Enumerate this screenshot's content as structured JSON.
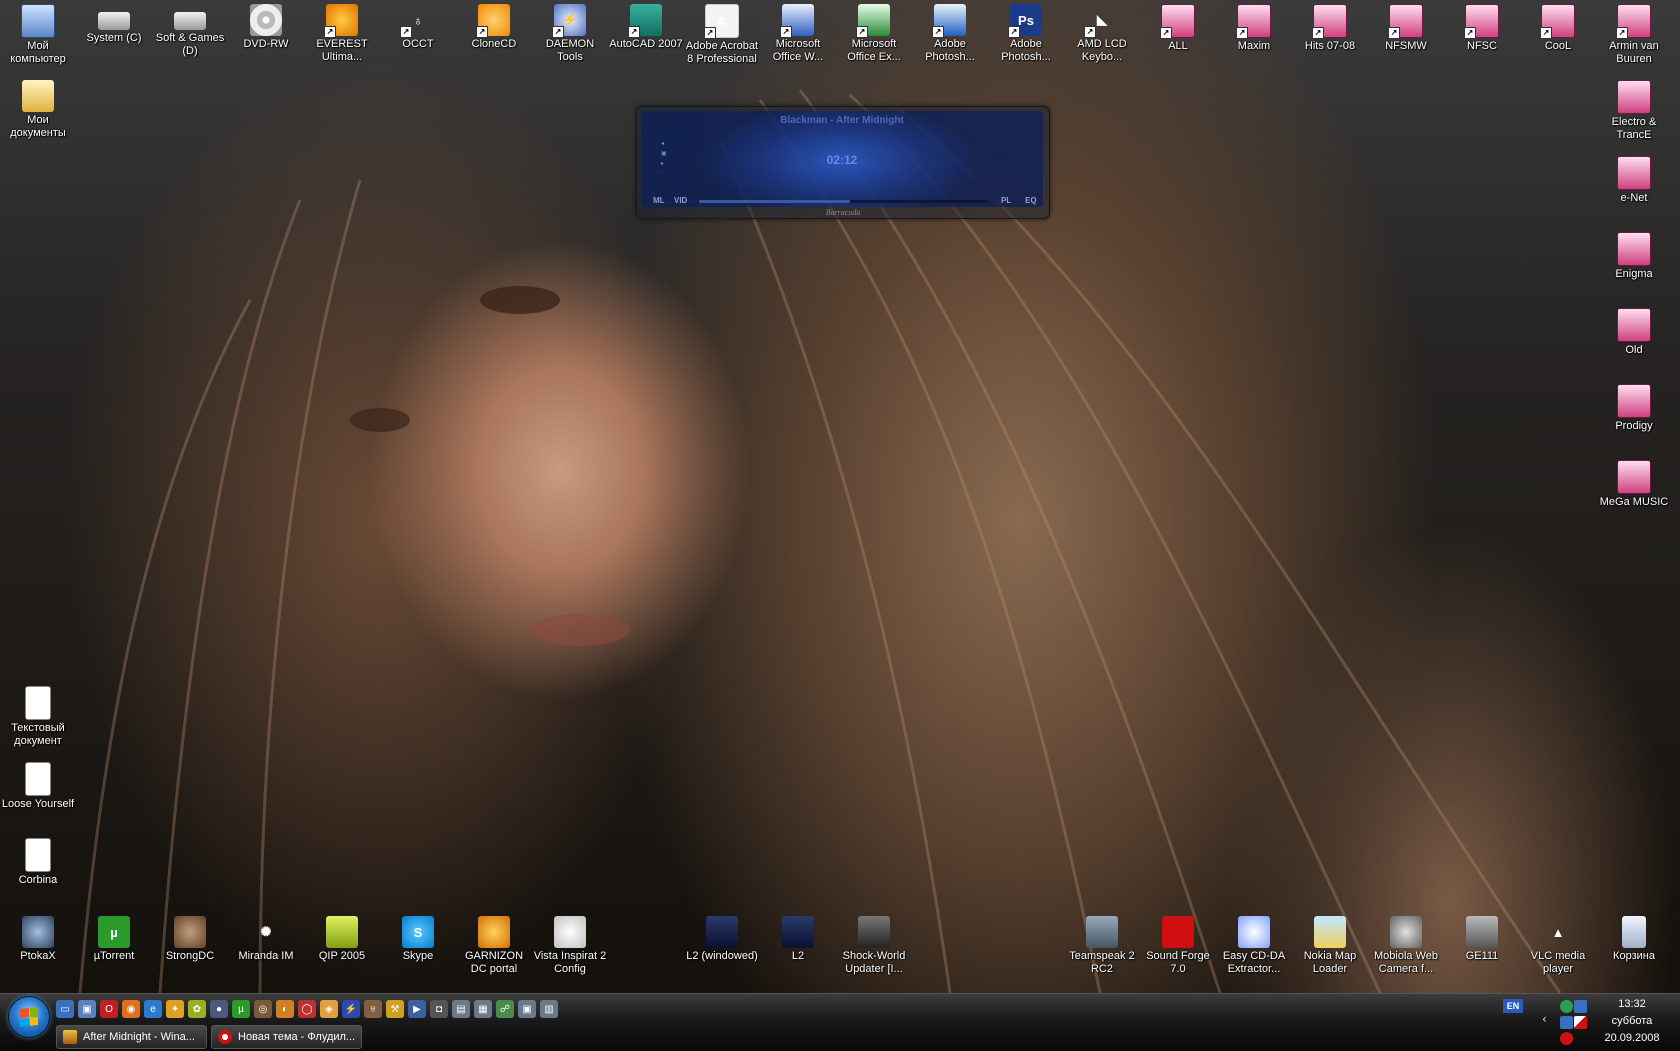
{
  "desktop": {
    "top_row": [
      {
        "label": "Мой компьютер",
        "icon": "my-computer-icon",
        "shortcut": false
      },
      {
        "label": "System (C)",
        "icon": "hard-drive-icon",
        "shortcut": false
      },
      {
        "label": "Soft & Games (D)",
        "icon": "hard-drive-icon",
        "shortcut": false
      },
      {
        "label": "DVD-RW",
        "icon": "dvd-drive-icon",
        "shortcut": false
      },
      {
        "label": "EVEREST Ultima...",
        "icon": "everest-icon",
        "shortcut": true
      },
      {
        "label": "OCCT",
        "icon": "occt-icon",
        "shortcut": true
      },
      {
        "label": "CloneCD",
        "icon": "clonecd-icon",
        "shortcut": true
      },
      {
        "label": "DAEMON Tools",
        "icon": "daemon-tools-icon",
        "shortcut": true
      },
      {
        "label": "AutoCAD 2007",
        "icon": "autocad-icon",
        "shortcut": true
      },
      {
        "label": "Adobe Acrobat 8 Professional",
        "icon": "acrobat-icon",
        "shortcut": true
      },
      {
        "label": "Microsoft Office W...",
        "icon": "word-icon",
        "shortcut": true
      },
      {
        "label": "Microsoft Office Ex...",
        "icon": "excel-icon",
        "shortcut": true
      },
      {
        "label": "Adobe Photosh...",
        "icon": "photoshop-old-icon",
        "shortcut": true
      },
      {
        "label": "Adobe Photosh...",
        "icon": "photoshop-icon",
        "shortcut": true
      },
      {
        "label": "AMD LCD Keybo...",
        "icon": "amd-icon",
        "shortcut": true
      },
      {
        "label": "ALL",
        "icon": "music-folder-icon",
        "shortcut": true
      },
      {
        "label": "Maxim",
        "icon": "music-folder-icon",
        "shortcut": true
      },
      {
        "label": "Hits 07-08",
        "icon": "music-folder-icon",
        "shortcut": true
      },
      {
        "label": "NFSMW",
        "icon": "music-folder-icon",
        "shortcut": true
      },
      {
        "label": "NFSC",
        "icon": "music-folder-icon",
        "shortcut": true
      },
      {
        "label": "CooL",
        "icon": "music-folder-icon",
        "shortcut": true
      },
      {
        "label": "Armin van Buuren",
        "icon": "music-folder-icon",
        "shortcut": true
      }
    ],
    "right_column": [
      {
        "label": "Electro & TrancE",
        "icon": "music-folder-icon"
      },
      {
        "label": "e-Net",
        "icon": "music-folder-icon"
      },
      {
        "label": "Enigma",
        "icon": "music-folder-icon"
      },
      {
        "label": "Old",
        "icon": "music-folder-icon"
      },
      {
        "label": "Prodigy",
        "icon": "music-folder-icon"
      },
      {
        "label": "MeGa MUSIC",
        "icon": "music-folder-icon"
      }
    ],
    "left_column": [
      {
        "label": "Мои документы",
        "icon": "my-documents-icon"
      }
    ],
    "left_files": [
      {
        "label": "Текстовый документ",
        "icon": "text-file-icon"
      },
      {
        "label": "Loose Yourself",
        "icon": "text-file-icon"
      },
      {
        "label": "Corbina",
        "icon": "text-file-icon"
      }
    ],
    "bottom_row": [
      {
        "label": "PtokaX",
        "icon": "ptokax-icon"
      },
      {
        "label": "µTorrent",
        "icon": "utorrent-icon"
      },
      {
        "label": "StrongDC",
        "icon": "strongdc-icon"
      },
      {
        "label": "Miranda IM",
        "icon": "miranda-icon"
      },
      {
        "label": "QIP 2005",
        "icon": "qip-icon"
      },
      {
        "label": "Skype",
        "icon": "skype-icon"
      },
      {
        "label": "GARNIZON DC portal",
        "icon": "garnizon-icon"
      },
      {
        "label": "Vista Inspirat 2 Config",
        "icon": "vista-inspirat-icon"
      },
      {
        "label": "L2 (windowed)",
        "icon": "lineage2-icon"
      },
      {
        "label": "L2",
        "icon": "lineage2-icon"
      },
      {
        "label": "Shock-World Updater [I...",
        "icon": "shock-world-icon"
      },
      {
        "label": "Teamspeak 2 RC2",
        "icon": "teamspeak-icon"
      },
      {
        "label": "Sound Forge 7.0",
        "icon": "sound-forge-icon"
      },
      {
        "label": "Easy CD-DA Extractor...",
        "icon": "easy-cd-da-icon"
      },
      {
        "label": "Nokia Map Loader",
        "icon": "nokia-map-icon"
      },
      {
        "label": "Mobiola Web Camera f...",
        "icon": "mobiola-icon"
      },
      {
        "label": "GE111",
        "icon": "camera-icon"
      },
      {
        "label": "VLC media player",
        "icon": "vlc-icon"
      },
      {
        "label": "Корзина",
        "icon": "recycle-bin-icon"
      }
    ]
  },
  "winamp": {
    "track": "Blackman - After Midnight",
    "time": "02:12",
    "progress": 0.52,
    "buttons": [
      "ML",
      "VID",
      "PL",
      "EQ"
    ],
    "brand": "Barracuda"
  },
  "taskbar": {
    "tasks": [
      {
        "label": "After Midnight - Wina...",
        "icon": "winamp-icon"
      },
      {
        "label": "Новая тема - Флудил...",
        "icon": "opera-icon"
      }
    ],
    "language": "EN",
    "clock": {
      "time": "13:32",
      "day": "суббота",
      "date": "20.09.2008"
    }
  }
}
